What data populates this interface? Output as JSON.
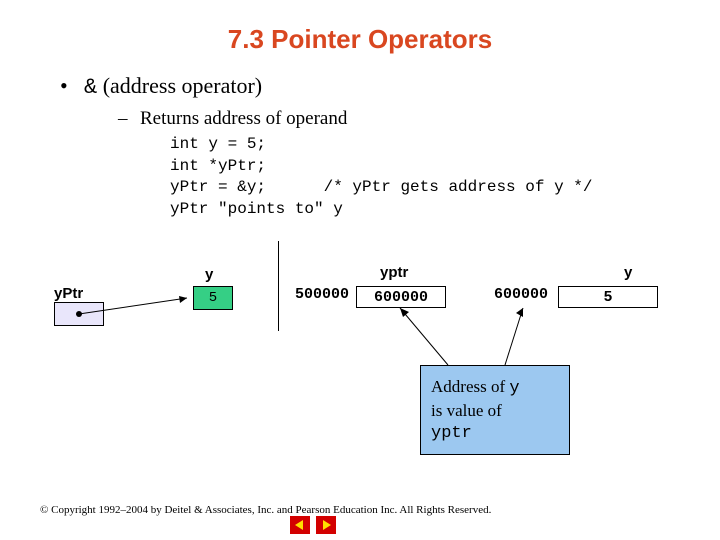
{
  "title": "7.3    Pointer Operators",
  "bullet1": {
    "amp": "&",
    "rest": " (address operator)"
  },
  "bullet2": "Returns address of operand",
  "code": "int y = 5;\nint *yPtr;\nyPtr = &y;      /* yPtr gets address of y */\nyPtr \"points to\" y",
  "labels": {
    "yPtr": "yPtr",
    "y_left": "y",
    "yptr_mid": "yptr",
    "y_right": "y",
    "green_value": "5",
    "mem_addr1": "500000",
    "mem_val1": "600000",
    "mem_addr2": "600000",
    "mem_val2": "5"
  },
  "callout": {
    "l1a": "Address of ",
    "l1b": "y",
    "l2a": "is value of",
    "l3": "yptr"
  },
  "footer": "© Copyright 1992–2004 by Deitel & Associates, Inc. and Pearson Education Inc. All Rights Reserved."
}
